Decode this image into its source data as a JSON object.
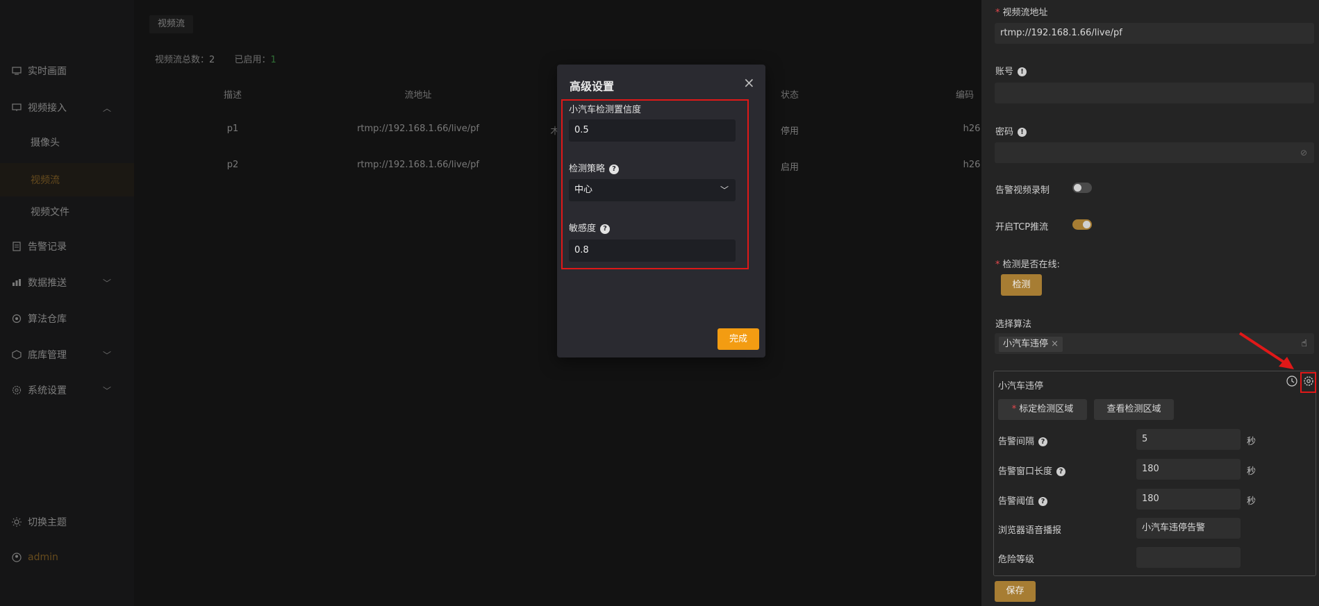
{
  "sidebar": {
    "items": [
      {
        "label": "实时画面",
        "icon": "monitor-icon"
      },
      {
        "label": "视频接入",
        "icon": "video-input-icon",
        "chevron": "︿"
      },
      {
        "label": "摄像头"
      },
      {
        "label": "视频流"
      },
      {
        "label": "视频文件"
      },
      {
        "label": "告警记录",
        "icon": "alarm-record-icon"
      },
      {
        "label": "数据推送",
        "icon": "data-push-icon",
        "chevron": "﹀"
      },
      {
        "label": "算法仓库",
        "icon": "algorithm-store-icon"
      },
      {
        "label": "底库管理",
        "icon": "base-library-icon",
        "chevron": "﹀"
      },
      {
        "label": "系统设置",
        "icon": "settings-icon",
        "chevron": "﹀"
      }
    ],
    "theme_toggle": "切换主题",
    "user": "admin"
  },
  "main": {
    "tab": "视频流",
    "stats": {
      "total_label": "视频流总数：",
      "total": "2",
      "enabled_label": "已启用：",
      "enabled": "1"
    },
    "table": {
      "headers": [
        "描述",
        "流地址",
        "状态",
        "编码"
      ],
      "rows": [
        {
          "desc": "p1",
          "url": "rtmp://192.168.1.66/live/pf",
          "partial": "木",
          "status": "停用",
          "codec": "h26"
        },
        {
          "desc": "p2",
          "url": "rtmp://192.168.1.66/live/pf",
          "partial": "",
          "status": "启用",
          "codec": "h26"
        }
      ]
    }
  },
  "dialog": {
    "title": "高级设置",
    "close": "×",
    "confidence_label": "小汽车检测置信度",
    "confidence_value": "0.5",
    "strategy_label": "检测策略",
    "strategy_value": "中心",
    "sensitivity_label": "敏感度",
    "sensitivity_value": "0.8",
    "done_button": "完成"
  },
  "panel": {
    "stream_url_label": "视频流地址",
    "stream_url": "rtmp://192.168.1.66/live/pf",
    "account_label": "账号",
    "password_label": "密码",
    "alarm_record_label": "告警视频录制",
    "alarm_record_on": false,
    "tcp_label": "开启TCP推流",
    "tcp_on": true,
    "online_label": "检测是否在线:",
    "detect_button": "检测",
    "algo_label": "选择算法",
    "algo_tag": "小汽车违停",
    "algo_tag_remove": "×",
    "algo_card": {
      "name": "小汽车违停",
      "mark_area_button": "标定检测区域",
      "view_area_button": "查看检测区域",
      "interval_label": "告警间隔",
      "interval_value": "5",
      "window_label": "告警窗口长度",
      "window_value": "180",
      "threshold_label": "告警阈值",
      "threshold_value": "180",
      "unit": "秒",
      "voice_label": "浏览器语音播报",
      "voice_value": "小汽车违停告警",
      "danger_label": "危险等级",
      "danger_value": ""
    },
    "save_button": "保存"
  },
  "colors": {
    "accent": "#a77d33",
    "highlight": "#e01818",
    "done": "#f39c12",
    "enabled": "#53c25e"
  }
}
